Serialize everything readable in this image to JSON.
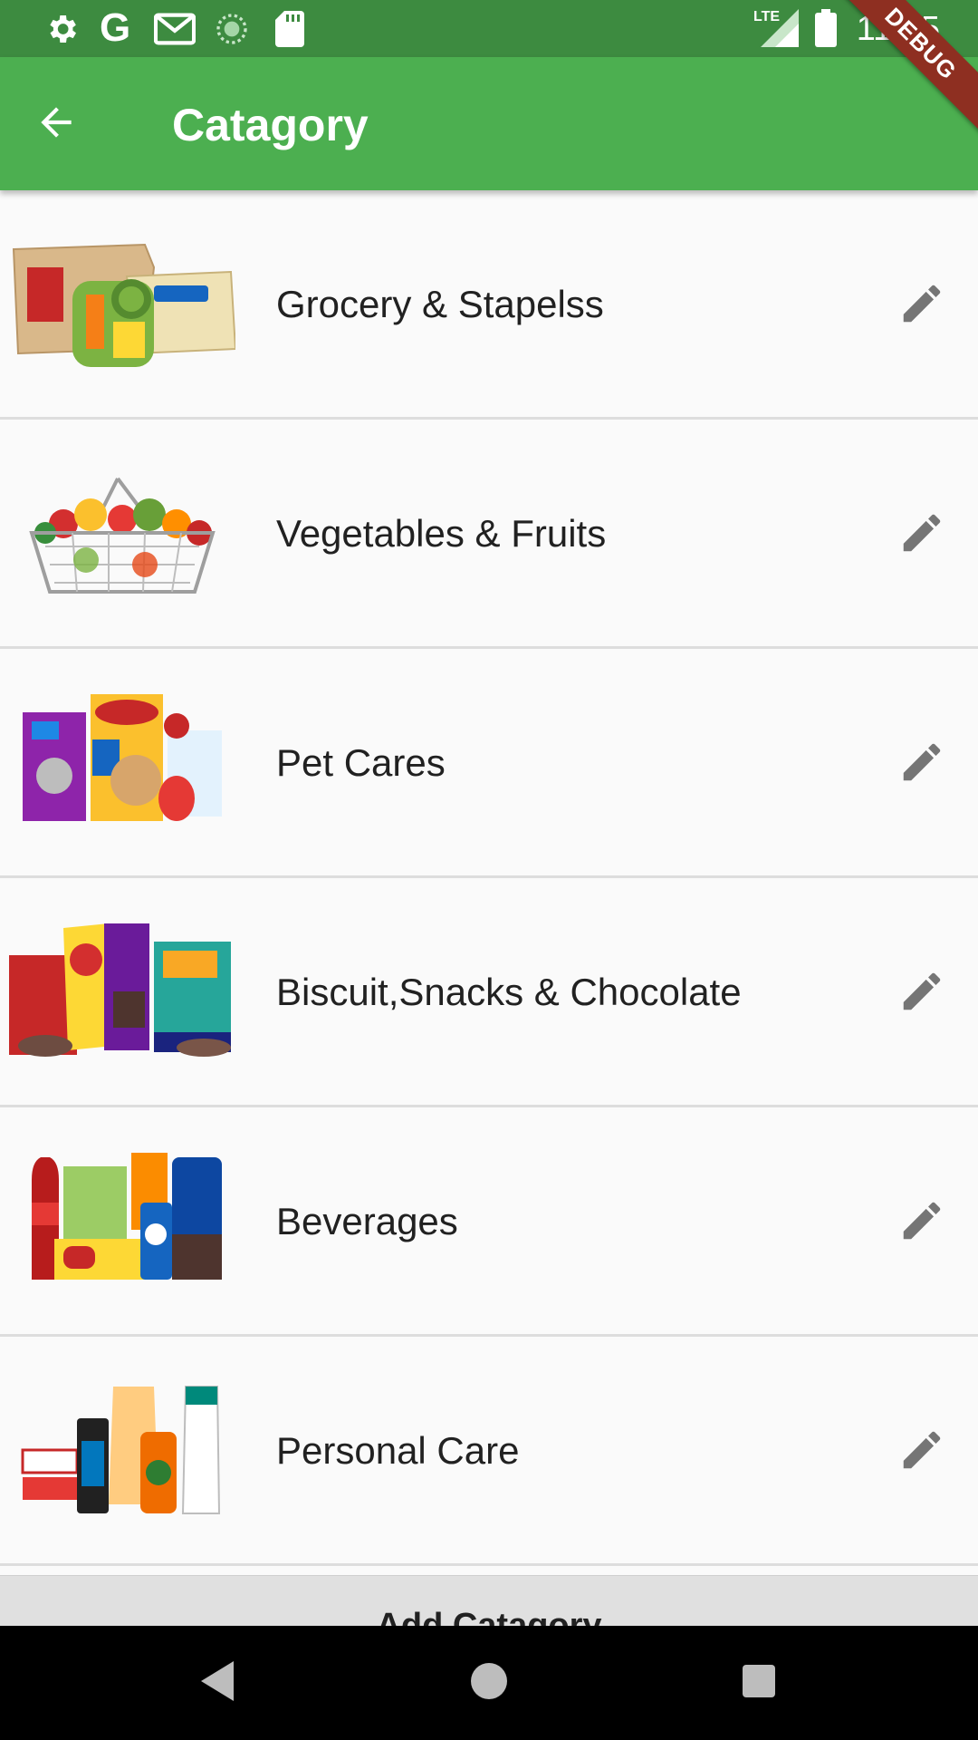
{
  "status_bar": {
    "time": "11:45",
    "icons": [
      "settings-icon",
      "google-icon",
      "gmail-icon",
      "sync-icon",
      "sd-card-icon",
      "lte-signal-icon",
      "battery-icon"
    ],
    "network_label": "LTE"
  },
  "debug_banner": "DEBUG",
  "app_bar": {
    "title": "Catagory",
    "back_icon": "arrow-back-icon",
    "background": "#4caf50"
  },
  "categories": [
    {
      "label": "Grocery & Stapelss",
      "image": "grocery-image"
    },
    {
      "label": "Vegetables & Fruits",
      "image": "vegetables-basket-image"
    },
    {
      "label": "Pet Cares",
      "image": "pet-food-image"
    },
    {
      "label": "Biscuit,Snacks & Chocolate",
      "image": "snacks-image"
    },
    {
      "label": "Beverages",
      "image": "beverages-image"
    },
    {
      "label": "Personal Care",
      "image": "personal-care-image"
    }
  ],
  "add_button": {
    "label": "Add Catagory"
  },
  "colors": {
    "accent": "#4caf50",
    "status_bar": "#3d8b40",
    "edit_icon": "#757575"
  }
}
